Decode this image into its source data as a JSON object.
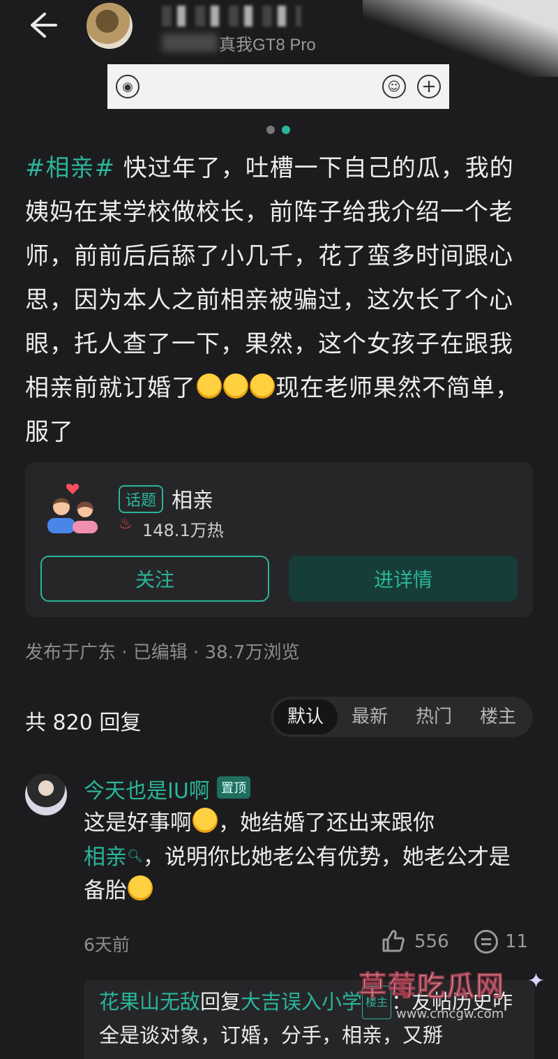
{
  "header": {
    "device_label": "真我GT8 Pro"
  },
  "post": {
    "hashtag": "#相亲#",
    "text_part1": " 快过年了，吐槽一下自己的瓜，我的姨妈在某学校做校长，前阵子给我介绍一个老师，前前后后舔了小几千，花了蛮多时间跟心思，因为本人之前相亲被骗过，这次长了个心眼，托人查了一下，果然，这个女孩子在跟我相亲前就订婚了",
    "text_part2": "现在老师果然不简单，服了"
  },
  "topic_card": {
    "tag": "话题",
    "name": "相亲",
    "heat": "148.1万热",
    "follow_label": "关注",
    "detail_label": "进详情"
  },
  "meta": "发布于广东 · 已编辑 · 38.7万浏览",
  "replies": {
    "count_label": "共 820 回复",
    "sort_options": [
      "默认",
      "最新",
      "热门",
      "楼主"
    ]
  },
  "comment": {
    "user": "今天也是IU啊",
    "pin_label": "置顶",
    "text_a": "这是好事啊",
    "text_b": "，她结婚了还出来跟你",
    "link": "相亲",
    "text_c": "，说明你比她老公有优势，她老公才是备胎",
    "time": "6天前",
    "likes": "556",
    "comments": "11"
  },
  "sub_reply": {
    "user": "花果山无敌",
    "reply_word": "回复",
    "target": "大吉误入小学",
    "op_label": "楼主",
    "text": "：友帖历史咋全是谈对象，订婚，分手，相亲，又掰"
  },
  "watermark": {
    "title": "草莓吃瓜网",
    "url": "www.cmcgw.com"
  },
  "colors": {
    "accent": "#2bb59a",
    "background": "#1c1c1e"
  }
}
